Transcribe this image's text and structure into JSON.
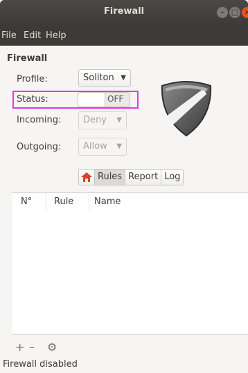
{
  "window": {
    "title": "Firewall",
    "controls": {
      "minimize": "–",
      "maximize": "□",
      "close": "×"
    }
  },
  "menu": {
    "file": "File",
    "edit": "Edit",
    "help": "Help"
  },
  "section_title": "Firewall",
  "fields": {
    "profile_label": "Profile:",
    "profile_value": "Soliton",
    "status_label": "Status:",
    "status_value": "OFF",
    "incoming_label": "Incoming:",
    "incoming_value": "Deny",
    "outgoing_label": "Outgoing:",
    "outgoing_value": "Allow"
  },
  "tabs": {
    "rules": "Rules",
    "report": "Report",
    "log": "Log"
  },
  "table": {
    "columns": [
      "N°",
      "Rule",
      "Name"
    ]
  },
  "tools": {
    "add": "+",
    "remove": "–",
    "settings": "⚙"
  },
  "statusbar": "Firewall disabled"
}
